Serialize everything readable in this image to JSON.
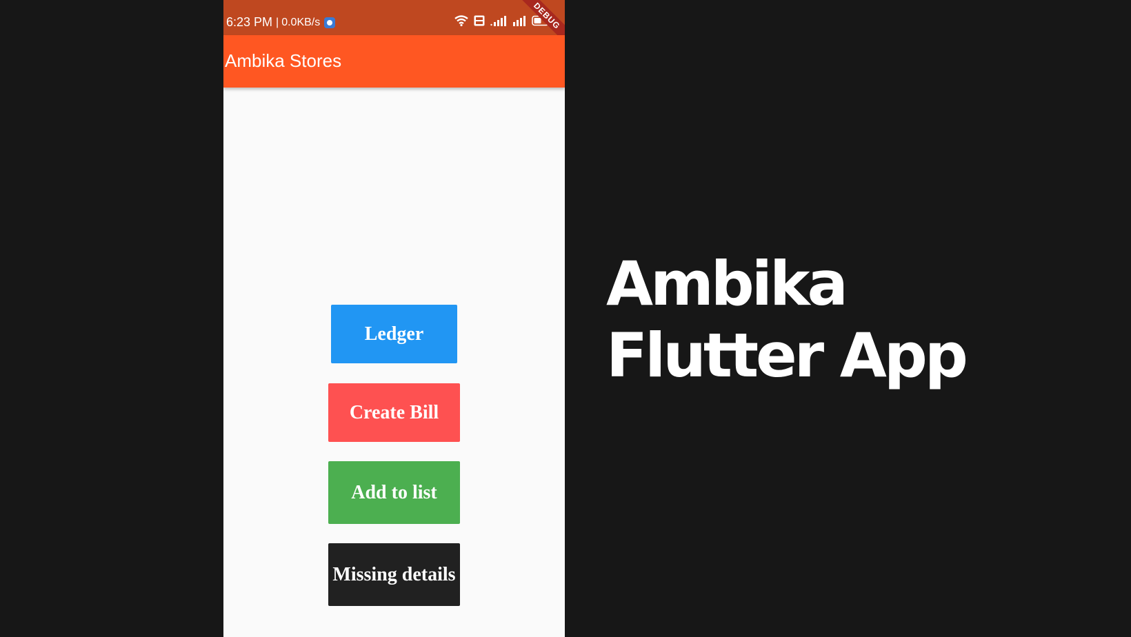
{
  "status_bar": {
    "time": "6:23 PM",
    "separator": "|",
    "network_speed": "0.0KB/s",
    "icons": [
      "app-notification-icon",
      "wifi-icon",
      "volte-icon",
      "signal-icon",
      "signal-icon",
      "battery-icon"
    ],
    "volte_label": "Vo LTE"
  },
  "debug_banner": "DEBUG",
  "app_bar": {
    "title": "Ambika Stores"
  },
  "buttons": {
    "ledger": "Ledger",
    "create_bill": "Create Bill",
    "add_to_list": "Add to list",
    "missing_details": "Missing details"
  },
  "video_title": {
    "line1": "Ambika",
    "line2": "Flutter App"
  },
  "colors": {
    "background": "#171717",
    "status_bar": "#bf4820",
    "app_bar": "#ff5722",
    "ledger": "#2196f3",
    "create_bill": "#fe5151",
    "add_to_list": "#4caf50",
    "missing_details": "#212121"
  }
}
